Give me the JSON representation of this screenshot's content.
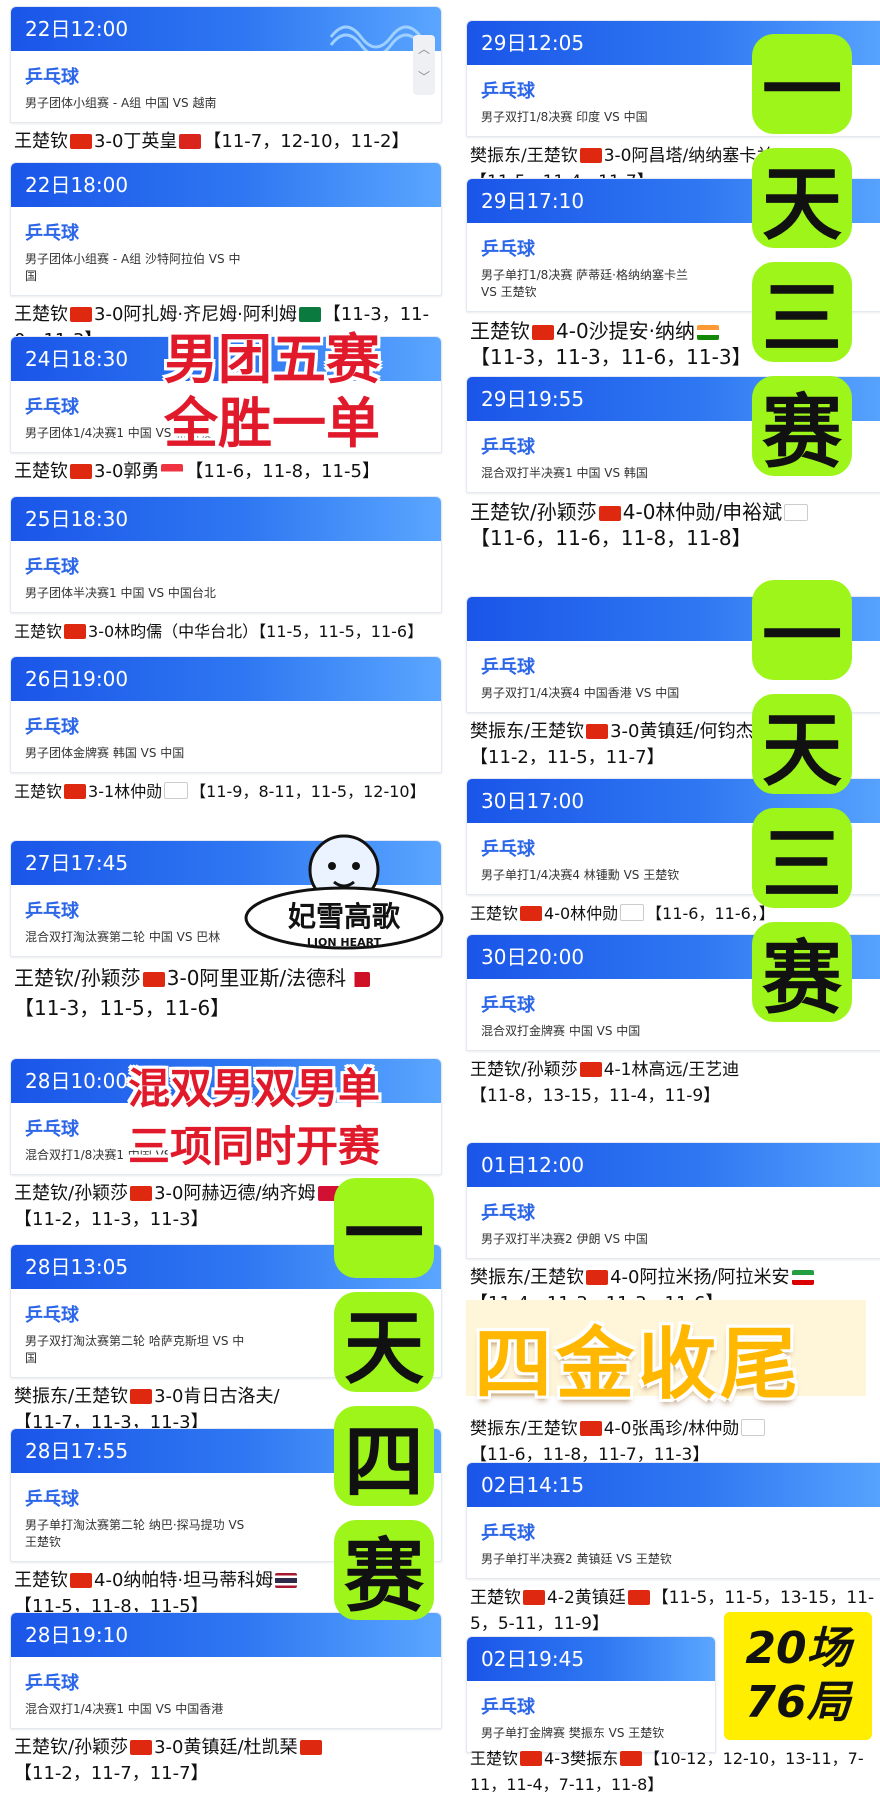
{
  "sport": "乒乓球",
  "left": [
    {
      "time": "22日12:00",
      "desc": "男子团体小组赛 - A组 中国 VS 越南",
      "result": [
        "王楚钦",
        "3-0丁英皇",
        "【11-7，12-10，11-2】"
      ],
      "flags": [
        "cn",
        "vn"
      ]
    },
    {
      "time": "22日18:00",
      "desc": "男子团体小组赛 - A组 沙特阿拉伯 VS 中国",
      "result": [
        "王楚钦",
        "3-0阿扎姆·齐尼姆·阿利姆",
        "【11-3，11-0，11-3】"
      ],
      "flags": [
        "cn",
        "sa"
      ]
    },
    {
      "time": "24日18:30",
      "desc": "男子团体1/4决赛1 中国 VS 新加坡",
      "result": [
        "王楚钦",
        "3-0郭勇",
        "【11-6，11-8，11-5】"
      ],
      "flags": [
        "cn",
        "sg"
      ]
    },
    {
      "time": "25日18:30",
      "desc": "男子团体半决赛1 中国 VS 中国台北",
      "result": [
        "王楚钦",
        "3-0林昀儒（中华台北）",
        "【11-5，11-5，11-6】"
      ],
      "flags": [
        "cn"
      ]
    },
    {
      "time": "26日19:00",
      "desc": "男子团体金牌赛 韩国 VS 中国",
      "result": [
        "王楚钦",
        "3-1林仲勋",
        "【11-9，8-11，11-5，12-10】"
      ],
      "flags": [
        "cn",
        "kr"
      ]
    },
    {
      "time": "27日17:45",
      "desc": "混合双打淘汰赛第二轮 中国 VS 巴林",
      "result": [
        "王楚钦/孙颖莎",
        "3-0阿里亚斯/法德科",
        "【11-3，11-5，11-6】"
      ],
      "flags": [
        "cn",
        "bh"
      ]
    },
    {
      "time": "28日10:00",
      "desc": "混合双打1/8决赛1 中国 VS 马尔代夫",
      "result": [
        "王楚钦/孙颖莎",
        "3-0阿赫迈德/纳齐姆",
        "【11-2，11-3，11-3】"
      ],
      "flags": [
        "cn",
        "mv"
      ]
    },
    {
      "time": "28日13:05",
      "desc": "男子双打淘汰赛第二轮 哈萨克斯坦 VS 中国",
      "result": [
        "樊振东/王楚钦",
        "3-0肯日古洛夫/",
        "【11-7，11-3，11-3】"
      ],
      "flags": [
        "cn"
      ]
    },
    {
      "time": "28日17:55",
      "desc": "男子单打淘汰赛第二轮 纳巴·探马提功 VS 王楚钦",
      "result": [
        "王楚钦",
        "4-0纳帕特·坦马蒂科姆",
        "【11-5，11-8，11-5】"
      ],
      "flags": [
        "cn",
        "th"
      ]
    },
    {
      "time": "28日19:10",
      "desc": "混合双打1/4决赛1 中国 VS 中国香港",
      "result": [
        "王楚钦/孙颖莎",
        "3-0黄镇廷/杜凯琹",
        "【11-2，11-7，11-7】"
      ],
      "flags": [
        "cn",
        "hk"
      ]
    }
  ],
  "right": [
    {
      "time": "29日12:05",
      "desc": "男子双打1/8决赛 印度 VS 中国",
      "result": [
        "樊振东/王楚钦",
        "3-0阿昌塔/纳纳塞卡兰",
        "【11-5，11-4，11-7】"
      ],
      "flags": [
        "cn",
        "in"
      ]
    },
    {
      "time": "29日17:10",
      "desc": "男子单打1/8决赛 萨蒂廷·格纳纳塞卡兰 VS 王楚钦",
      "result": [
        "王楚钦",
        "4-0沙提安·纳纳",
        "【11-3，11-3，11-6，11-3】"
      ],
      "flags": [
        "cn",
        "in"
      ]
    },
    {
      "time": "29日19:55",
      "desc": "混合双打半决赛1 中国 VS 韩国",
      "result": [
        "王楚钦/孙颖莎",
        "4-0林仲勋/申裕斌",
        "【11-6，11-6，11-8，11-8】"
      ],
      "flags": [
        "cn",
        "kr"
      ]
    },
    {
      "time": "",
      "desc": "男子双打1/4决赛4 中国香港 VS 中国",
      "result": [
        "樊振东/王楚钦",
        "3-0黄镇廷/何钧杰",
        "【11-2，11-5，11-7】"
      ],
      "flags": [
        "cn",
        "hk"
      ]
    },
    {
      "time": "30日17:00",
      "desc": "男子单打1/4决赛4 林锺勳 VS 王楚钦",
      "result": [
        "王楚钦",
        "4-0林仲勋",
        "【11-6，11-6，】"
      ],
      "flags": [
        "cn",
        "kr"
      ]
    },
    {
      "time": "30日20:00",
      "desc": "混合双打金牌赛 中国 VS 中国",
      "result": [
        "王楚钦/孙颖莎",
        "4-1林高远/王艺迪",
        "【11-8，13-15，11-4，11-9】"
      ],
      "flags": [
        "cn"
      ]
    },
    {
      "time": "01日12:00",
      "desc": "男子双打半决赛2 伊朗 VS 中国",
      "result": [
        "樊振东/王楚钦",
        "4-0阿拉米扬/阿拉米安",
        "【11-4，11-3，11-3，11-6】"
      ],
      "flags": [
        "cn",
        "ir"
      ]
    },
    {
      "time": "",
      "desc": "",
      "result": [
        "樊振东/王楚钦",
        "4-0张禹珍/林仲勋",
        "【11-6，11-8，11-7，11-3】"
      ],
      "flags": [
        "cn",
        "kr"
      ]
    },
    {
      "time": "02日14:15",
      "desc": "男子单打半决赛2 黄镇廷 VS 王楚钦",
      "result": [
        "王楚钦",
        "4-2黄镇廷",
        "【11-5，11-5，13-15，11-5，5-11，11-9】"
      ],
      "flags": [
        "cn",
        "hk"
      ]
    },
    {
      "time": "02日19:45",
      "desc": "男子单打金牌赛 樊振东 VS 王楚钦",
      "result": [
        "王楚钦",
        "4-3樊振东",
        "【10-12，12-10，13-11，7-11，11-4，7-11，11-8】"
      ],
      "flags": [
        "cn",
        "cn"
      ]
    }
  ],
  "overlays": {
    "red1_line1": "男团五赛",
    "red1_line2": "全胜一单",
    "red2_line1": "混双男双男单",
    "red2_line2": "三项同时开赛",
    "green_a": [
      "一",
      "天",
      "三",
      "赛"
    ],
    "green_b": [
      "一",
      "天",
      "三",
      "赛"
    ],
    "green_c": [
      "一",
      "天",
      "四",
      "赛"
    ],
    "gold": "四金收尾",
    "yellow_1": "20场",
    "yellow_2": "76局",
    "logo_main": "妃雪高歌",
    "logo_sub": "LION HEART"
  },
  "colors": {
    "header": "#1a55e8",
    "sport": "#2b66e8",
    "red": "#e0192b",
    "green": "#9ef51a",
    "gold": "#ffb700",
    "yellow": "#ffee00"
  }
}
